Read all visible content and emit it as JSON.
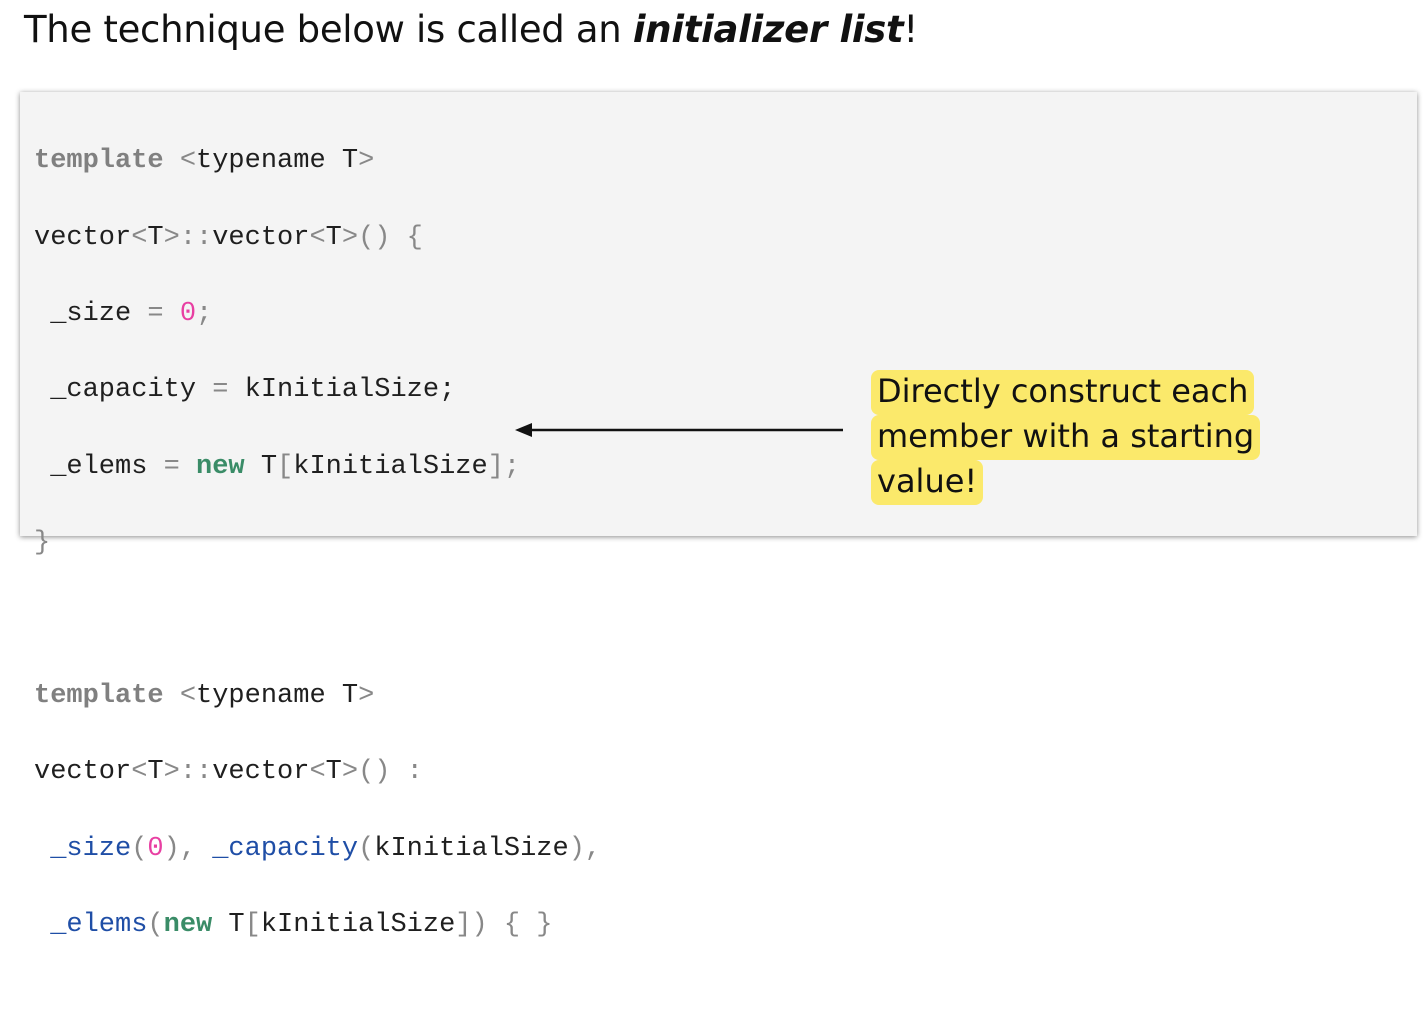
{
  "heading": {
    "prefix": "The technique below is called an ",
    "emphasis": "initializer list",
    "suffix": "!"
  },
  "code_block_1": {
    "l1": {
      "kw": "template",
      "p1": " ",
      "lt": "<",
      "t": "typename T",
      "gt": ">"
    },
    "l2": {
      "a": "vector",
      "lt1": "<",
      "b": "T",
      "gt1": ">",
      "cc": "::",
      "c": "vector",
      "lt2": "<",
      "d": "T",
      "gt2": ">",
      "e": "() {"
    },
    "l3": {
      "a": " _size ",
      "eq": "=",
      "sp": " ",
      "num": "0",
      "semi": ";"
    },
    "l4": {
      "a": " _capacity ",
      "eq": "=",
      "b": " kInitialSize;"
    },
    "l5": {
      "a": " _elems ",
      "eq": "=",
      "sp": " ",
      "kn": "new",
      "b": " T",
      "lb": "[",
      "c": "kInitialSize",
      "rb": "]",
      "semi": ";"
    },
    "l6": {
      "a": "}"
    }
  },
  "code_block_2": {
    "l1": {
      "kw": "template",
      "p1": " ",
      "lt": "<",
      "t": "typename T",
      "gt": ">"
    },
    "l2": {
      "a": "vector",
      "lt1": "<",
      "b": "T",
      "gt1": ">",
      "cc": "::",
      "c": "vector",
      "lt2": "<",
      "d": "T",
      "gt2": ">",
      "e": "() :"
    },
    "l3": {
      "pad": " ",
      "f1": "_size",
      "o1": "(",
      "n1": "0",
      "c1": "), ",
      "f2": "_capacity",
      "o2": "(",
      "v2": "kInitialSize",
      "c2": "),",
      "ec": ""
    },
    "l4": {
      "pad": " ",
      "f3": "_elems",
      "o3": "(",
      "kn": "new",
      "v3": " T",
      "lb": "[",
      "v4": "kInitialSize",
      "rb": "]",
      "c3": ") { }"
    }
  },
  "callout": {
    "line1": "Directly construct each",
    "line2": "member with a starting",
    "line3": "value!"
  },
  "colors": {
    "keyword": "#808080",
    "new_keyword": "#3a8c67",
    "number": "#e83fa2",
    "member": "#1f4ea6",
    "highlight": "#fbe96b"
  }
}
